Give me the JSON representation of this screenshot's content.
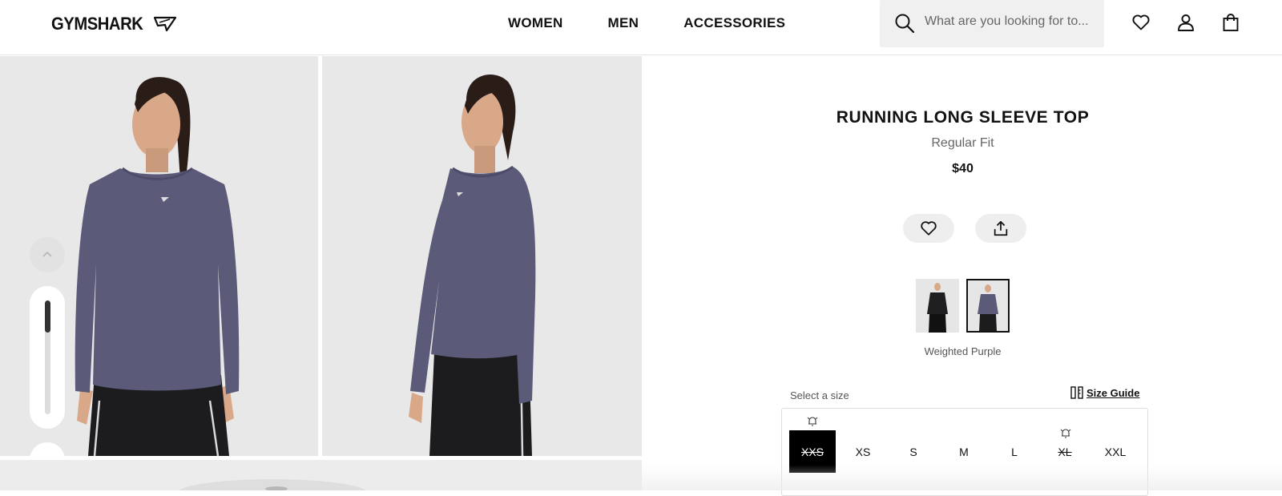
{
  "brand": {
    "name": "GYMSHARK"
  },
  "nav": {
    "items": [
      "WOMEN",
      "MEN",
      "ACCESSORIES"
    ]
  },
  "search": {
    "placeholder": "What are you looking for to..."
  },
  "header_icons": [
    "heart-icon",
    "account-icon",
    "bag-icon"
  ],
  "product": {
    "title": "RUNNING LONG SLEEVE TOP",
    "fit": "Regular Fit",
    "price": "$40",
    "color_name": "Weighted Purple",
    "swatches": [
      {
        "color": "Black",
        "selected": false
      },
      {
        "color": "Weighted Purple",
        "selected": true
      }
    ],
    "size_label": "Select a size",
    "size_guide": "Size Guide",
    "sizes": [
      {
        "label": "XXS",
        "selected": true,
        "available": false,
        "notify": true
      },
      {
        "label": "XS",
        "selected": false,
        "available": true,
        "notify": false
      },
      {
        "label": "S",
        "selected": false,
        "available": true,
        "notify": false
      },
      {
        "label": "M",
        "selected": false,
        "available": true,
        "notify": false
      },
      {
        "label": "L",
        "selected": false,
        "available": true,
        "notify": false
      },
      {
        "label": "XL",
        "selected": false,
        "available": false,
        "notify": true
      },
      {
        "label": "XXL",
        "selected": false,
        "available": true,
        "notify": false
      }
    ]
  },
  "colors": {
    "garment": "#5b5a78",
    "leggings": "#1c1c1e",
    "skin": "#d9a889",
    "hair": "#2a1d18",
    "bg": "#e8e8e8"
  }
}
